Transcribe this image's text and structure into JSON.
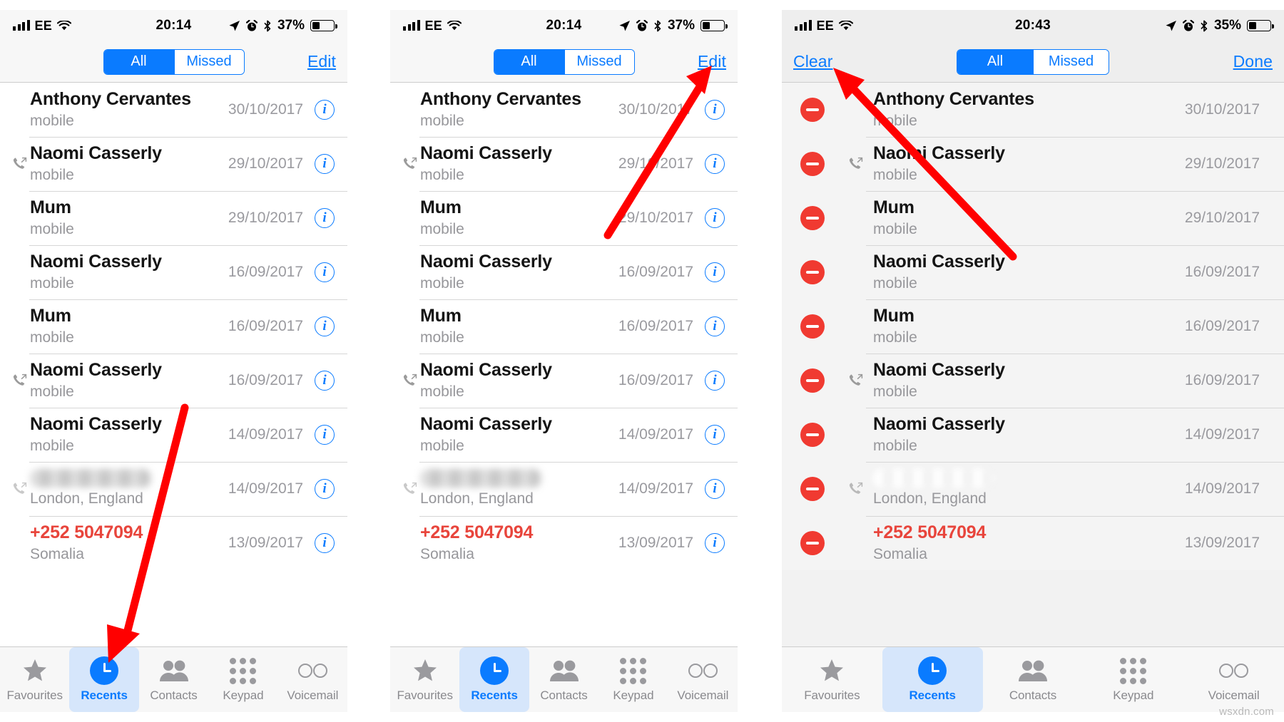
{
  "watermark": "wsxdn.com",
  "colors": {
    "accent_blue": "#0a7bff",
    "delete_red": "#f03a31",
    "missed_call_red": "#e8453c",
    "tab_active_bg": "#d6e6fb",
    "arrow_red": "#ff0000",
    "subtitle_grey": "#97979b"
  },
  "panels": [
    {
      "id": "panel-all-recents",
      "status_bar": {
        "carrier": "EE",
        "time": "20:14",
        "battery_percent": "37%",
        "icons": [
          "signal-bars-icon",
          "wifi-icon",
          "location-arrow-icon",
          "alarm-clock-icon",
          "bluetooth-icon",
          "battery-icon"
        ]
      },
      "nav_bar": {
        "left_button": "",
        "segments": [
          {
            "label": "All",
            "active": true
          },
          {
            "label": "Missed",
            "active": false
          }
        ],
        "right_button": "Edit"
      },
      "edit_mode": false,
      "rows": [
        {
          "name": "Anthony Cervantes",
          "subtitle": "mobile",
          "date": "30/10/2017",
          "direction": "none",
          "missed": false,
          "blurred": false
        },
        {
          "name": "Naomi Casserly",
          "subtitle": "mobile",
          "date": "29/10/2017",
          "direction": "outgoing",
          "missed": false,
          "blurred": false
        },
        {
          "name": "Mum",
          "subtitle": "mobile",
          "date": "29/10/2017",
          "direction": "none",
          "missed": false,
          "blurred": false
        },
        {
          "name": "Naomi Casserly",
          "subtitle": "mobile",
          "date": "16/09/2017",
          "direction": "none",
          "missed": false,
          "blurred": false
        },
        {
          "name": "Mum",
          "subtitle": "mobile",
          "date": "16/09/2017",
          "direction": "none",
          "missed": false,
          "blurred": false
        },
        {
          "name": "Naomi Casserly",
          "subtitle": "mobile",
          "date": "16/09/2017",
          "direction": "outgoing",
          "missed": false,
          "blurred": false
        },
        {
          "name": "Naomi Casserly",
          "subtitle": "mobile",
          "date": "14/09/2017",
          "direction": "none",
          "missed": false,
          "blurred": false
        },
        {
          "name": "",
          "subtitle": "London, England",
          "date": "14/09/2017",
          "direction": "outgoing",
          "missed": false,
          "blurred": true
        },
        {
          "name": "+252 5047094",
          "subtitle": "Somalia",
          "date": "13/09/2017",
          "direction": "none",
          "missed": true,
          "blurred": false
        }
      ],
      "tabs": [
        {
          "label": "Favourites",
          "icon": "star-icon",
          "active": false
        },
        {
          "label": "Recents",
          "icon": "clock-icon",
          "active": true
        },
        {
          "label": "Contacts",
          "icon": "people-icon",
          "active": false
        },
        {
          "label": "Keypad",
          "icon": "keypad-icon",
          "active": false
        },
        {
          "label": "Voicemail",
          "icon": "voicemail-icon",
          "active": false
        }
      ]
    },
    {
      "id": "panel-edit-highlight",
      "status_bar": {
        "carrier": "EE",
        "time": "20:14",
        "battery_percent": "37%",
        "icons": [
          "signal-bars-icon",
          "wifi-icon",
          "location-arrow-icon",
          "alarm-clock-icon",
          "bluetooth-icon",
          "battery-icon"
        ]
      },
      "nav_bar": {
        "left_button": "",
        "segments": [
          {
            "label": "All",
            "active": true
          },
          {
            "label": "Missed",
            "active": false
          }
        ],
        "right_button": "Edit"
      },
      "edit_mode": false,
      "rows": [
        {
          "name": "Anthony Cervantes",
          "subtitle": "mobile",
          "date": "30/10/2017",
          "direction": "none",
          "missed": false,
          "blurred": false
        },
        {
          "name": "Naomi Casserly",
          "subtitle": "mobile",
          "date": "29/10/2017",
          "direction": "outgoing",
          "missed": false,
          "blurred": false
        },
        {
          "name": "Mum",
          "subtitle": "mobile",
          "date": "29/10/2017",
          "direction": "none",
          "missed": false,
          "blurred": false
        },
        {
          "name": "Naomi Casserly",
          "subtitle": "mobile",
          "date": "16/09/2017",
          "direction": "none",
          "missed": false,
          "blurred": false
        },
        {
          "name": "Mum",
          "subtitle": "mobile",
          "date": "16/09/2017",
          "direction": "none",
          "missed": false,
          "blurred": false
        },
        {
          "name": "Naomi Casserly",
          "subtitle": "mobile",
          "date": "16/09/2017",
          "direction": "outgoing",
          "missed": false,
          "blurred": false
        },
        {
          "name": "Naomi Casserly",
          "subtitle": "mobile",
          "date": "14/09/2017",
          "direction": "none",
          "missed": false,
          "blurred": false
        },
        {
          "name": "",
          "subtitle": "London, England",
          "date": "14/09/2017",
          "direction": "outgoing",
          "missed": false,
          "blurred": true
        },
        {
          "name": "+252 5047094",
          "subtitle": "Somalia",
          "date": "13/09/2017",
          "direction": "none",
          "missed": true,
          "blurred": false
        }
      ],
      "tabs": [
        {
          "label": "Favourites",
          "icon": "star-icon",
          "active": false
        },
        {
          "label": "Recents",
          "icon": "clock-icon",
          "active": true
        },
        {
          "label": "Contacts",
          "icon": "people-icon",
          "active": false
        },
        {
          "label": "Keypad",
          "icon": "keypad-icon",
          "active": false
        },
        {
          "label": "Voicemail",
          "icon": "voicemail-icon",
          "active": false
        }
      ]
    },
    {
      "id": "panel-clear-mode",
      "status_bar": {
        "carrier": "EE",
        "time": "20:43",
        "battery_percent": "35%",
        "icons": [
          "signal-bars-icon",
          "wifi-icon",
          "location-arrow-icon",
          "alarm-clock-icon",
          "bluetooth-icon",
          "battery-icon"
        ]
      },
      "nav_bar": {
        "left_button": "Clear",
        "segments": [
          {
            "label": "All",
            "active": true
          },
          {
            "label": "Missed",
            "active": false
          }
        ],
        "right_button": "Done"
      },
      "edit_mode": true,
      "rows": [
        {
          "name": "Anthony Cervantes",
          "subtitle": "mobile",
          "date": "30/10/2017",
          "direction": "none",
          "missed": false,
          "blurred": false
        },
        {
          "name": "Naomi Casserly",
          "subtitle": "mobile",
          "date": "29/10/2017",
          "direction": "outgoing",
          "missed": false,
          "blurred": false
        },
        {
          "name": "Mum",
          "subtitle": "mobile",
          "date": "29/10/2017",
          "direction": "none",
          "missed": false,
          "blurred": false
        },
        {
          "name": "Naomi Casserly",
          "subtitle": "mobile",
          "date": "16/09/2017",
          "direction": "none",
          "missed": false,
          "blurred": false
        },
        {
          "name": "Mum",
          "subtitle": "mobile",
          "date": "16/09/2017",
          "direction": "none",
          "missed": false,
          "blurred": false
        },
        {
          "name": "Naomi Casserly",
          "subtitle": "mobile",
          "date": "16/09/2017",
          "direction": "outgoing",
          "missed": false,
          "blurred": false
        },
        {
          "name": "Naomi Casserly",
          "subtitle": "mobile",
          "date": "14/09/2017",
          "direction": "none",
          "missed": false,
          "blurred": false
        },
        {
          "name": "",
          "subtitle": "London, England",
          "date": "14/09/2017",
          "direction": "outgoing",
          "missed": false,
          "blurred": true
        },
        {
          "name": "+252 5047094",
          "subtitle": "Somalia",
          "date": "13/09/2017",
          "direction": "none",
          "missed": true,
          "blurred": false
        }
      ],
      "tabs": [
        {
          "label": "Favourites",
          "icon": "star-icon",
          "active": false
        },
        {
          "label": "Recents",
          "icon": "clock-icon",
          "active": true
        },
        {
          "label": "Contacts",
          "icon": "people-icon",
          "active": false
        },
        {
          "label": "Keypad",
          "icon": "keypad-icon",
          "active": false
        },
        {
          "label": "Voicemail",
          "icon": "voicemail-icon",
          "active": false
        }
      ]
    }
  ],
  "annotations": [
    {
      "name": "arrow-to-recents-tab",
      "points_to": "Recents tab (panel 1)"
    },
    {
      "name": "arrow-to-edit-button",
      "points_to": "Edit button (panel 2)"
    },
    {
      "name": "arrow-to-clear-button",
      "points_to": "Clear button (panel 3)"
    }
  ]
}
